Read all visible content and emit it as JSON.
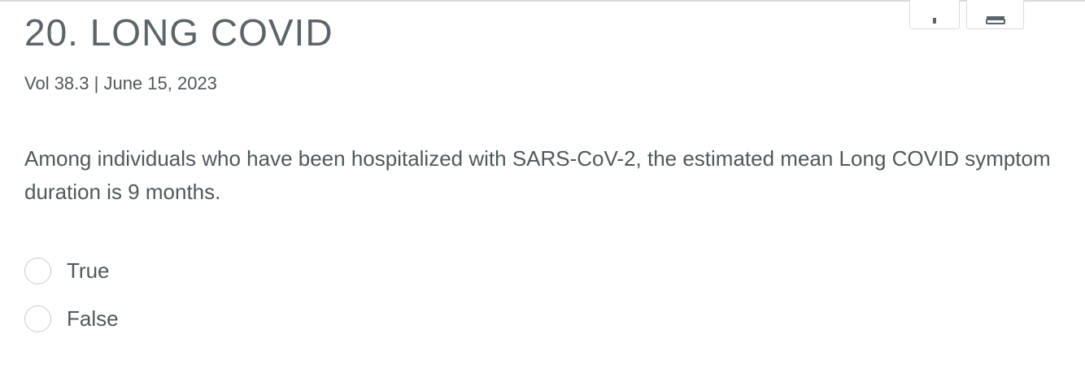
{
  "header": {
    "title": "20. LONG COVID",
    "meta": "Vol 38.3 | June 15, 2023"
  },
  "toolbar": {
    "help_icon": "question-mark-icon",
    "print_icon": "printer-icon"
  },
  "question": {
    "text": "Among individuals who have been hospitalized with SARS-CoV-2, the estimated mean Long COVID symptom duration is 9 months.",
    "options": [
      {
        "label": "True",
        "selected": false
      },
      {
        "label": "False",
        "selected": false
      }
    ]
  },
  "colors": {
    "text": "#4f585c",
    "border": "#d9dcdd"
  }
}
